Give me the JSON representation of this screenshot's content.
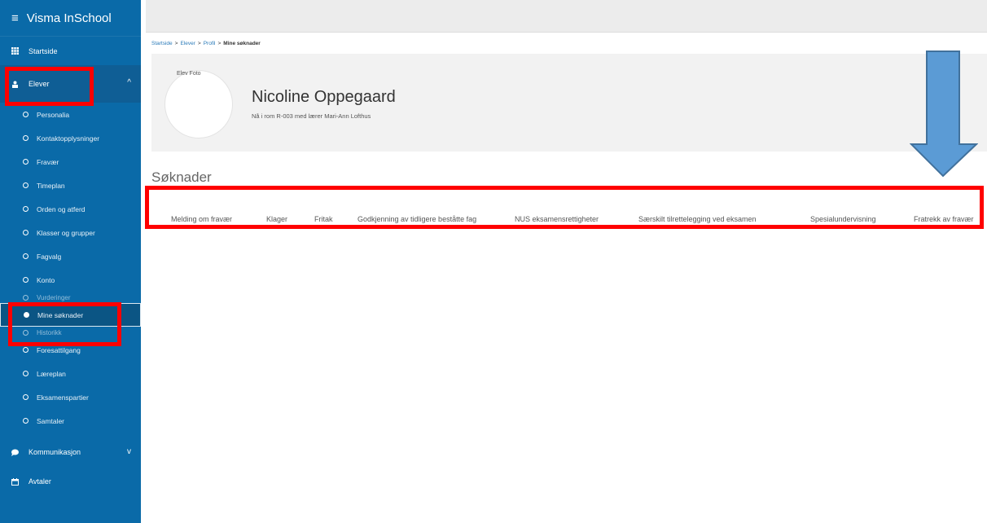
{
  "sidebar": {
    "brand": "Visma InSchool",
    "startside": "Startside",
    "elever": "Elever",
    "items": [
      "Personalia",
      "Kontaktopplysninger",
      "Fravær",
      "Timeplan",
      "Orden og atferd",
      "Klasser og grupper",
      "Fagvalg",
      "Konto",
      "Vurderinger",
      "Mine søknader",
      "Historikk",
      "Foresattilgang",
      "Læreplan",
      "Eksamenspartier",
      "Samtaler"
    ],
    "kommunikasjon": "Kommunikasjon",
    "avtaler": "Avtaler"
  },
  "breadcrumb": {
    "startside": "Startside",
    "elever": "Elever",
    "profil": "Profil",
    "current": "Mine søknader"
  },
  "profile": {
    "photo_alt": "Elev Foto",
    "name": "Nicoline Oppegaard",
    "location": "Nå i rom R-003 med lærer Mari-Ann Lofthus"
  },
  "heading": "Søknader",
  "tabs": [
    "Melding om fravær",
    "Klager",
    "Fritak",
    "Godkjenning av tidligere beståtte fag",
    "NUS eksamensrettigheter",
    "Særskilt tilrettelegging ved eksamen",
    "Spesialundervisning",
    "Fratrekk av fravær"
  ],
  "colors": {
    "sidebar": "#0a6aa8",
    "annotation": "#ff0000",
    "arrow": "#5b9bd5"
  }
}
